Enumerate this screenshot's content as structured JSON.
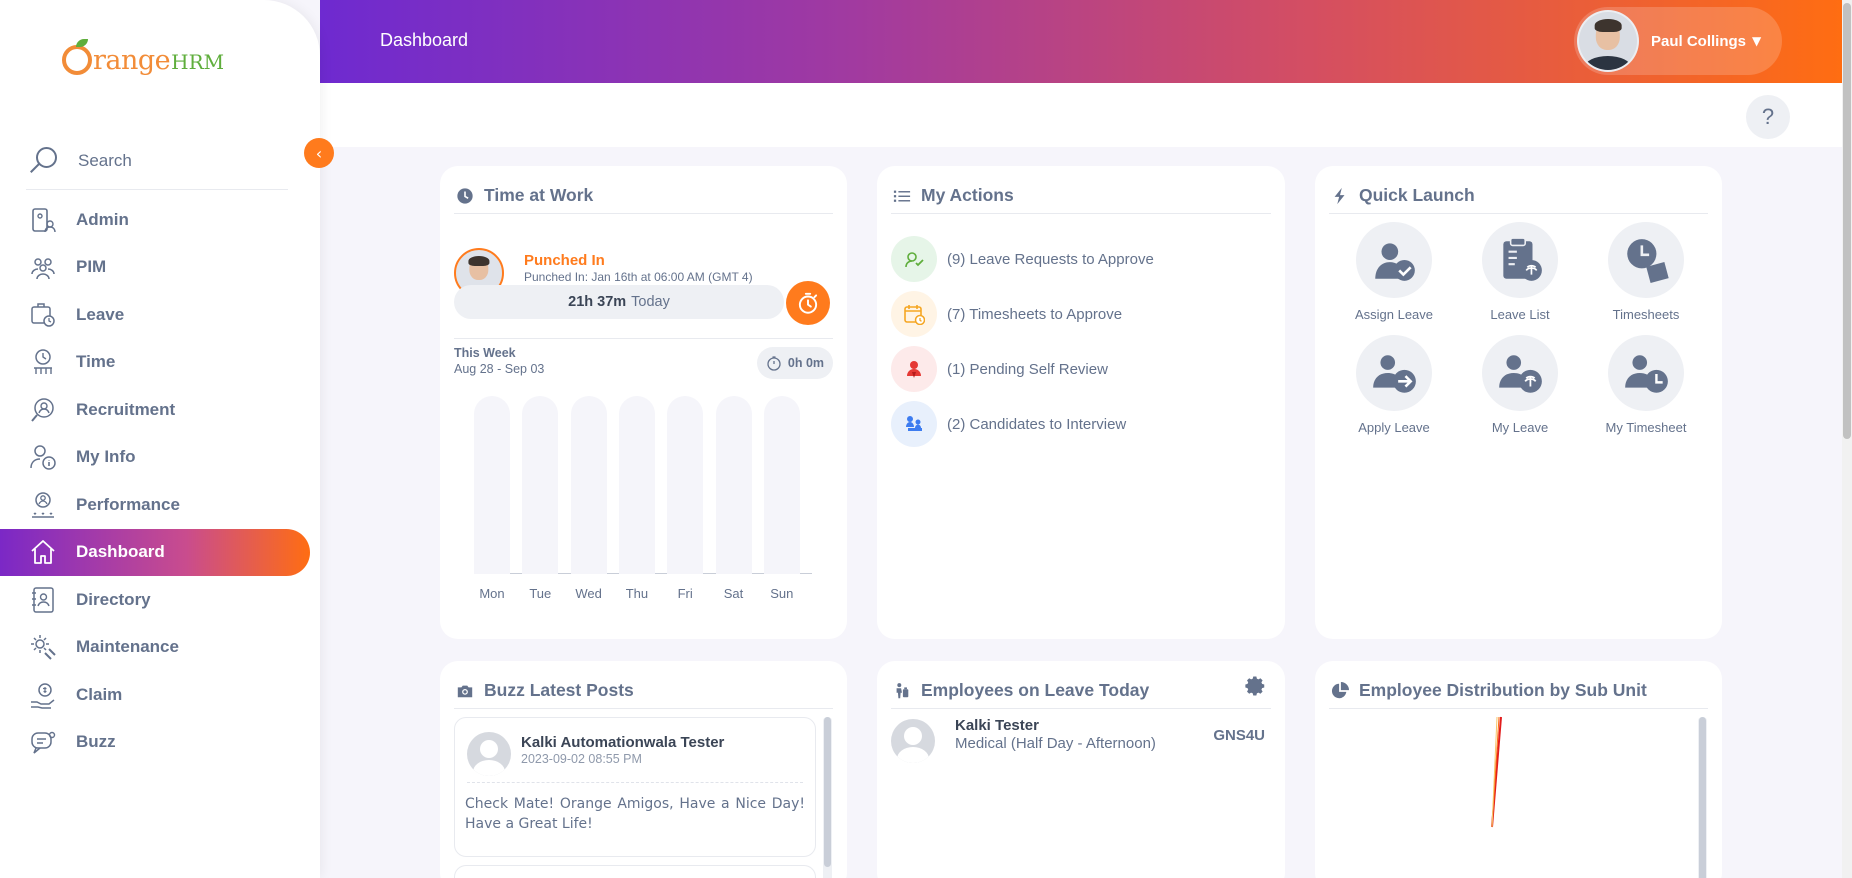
{
  "brand": {
    "logo_text": "range",
    "logo_suffix": "HRM"
  },
  "header": {
    "breadcrumb": "Dashboard",
    "user_name": "Paul Collings",
    "help_label": "?"
  },
  "sidebar": {
    "search_placeholder": "Search",
    "collapse_glyph": "‹",
    "items": [
      {
        "label": "Admin",
        "icon": "admin-icon"
      },
      {
        "label": "PIM",
        "icon": "pim-icon"
      },
      {
        "label": "Leave",
        "icon": "leave-icon"
      },
      {
        "label": "Time",
        "icon": "time-icon"
      },
      {
        "label": "Recruitment",
        "icon": "recruitment-icon"
      },
      {
        "label": "My Info",
        "icon": "my-info-icon"
      },
      {
        "label": "Performance",
        "icon": "performance-icon"
      },
      {
        "label": "Dashboard",
        "icon": "home-icon",
        "active": true
      },
      {
        "label": "Directory",
        "icon": "directory-icon"
      },
      {
        "label": "Maintenance",
        "icon": "maintenance-icon"
      },
      {
        "label": "Claim",
        "icon": "claim-icon"
      },
      {
        "label": "Buzz",
        "icon": "buzz-icon"
      }
    ]
  },
  "time_at_work": {
    "title": "Time at Work",
    "status": "Punched In",
    "punched_detail": "Punched In: Jan 16th at 06:00 AM (GMT 4)",
    "today_hours": "21h 37m",
    "today_label": "Today",
    "week_label": "This Week",
    "week_range": "Aug 28 - Sep 03",
    "week_total": "0h 0m",
    "days": [
      "Mon",
      "Tue",
      "Wed",
      "Thu",
      "Fri",
      "Sat",
      "Sun"
    ]
  },
  "my_actions": {
    "title": "My Actions",
    "items": [
      {
        "label": "(9) Leave Requests to Approve",
        "color": "#e6f5e8",
        "icon": "leave-request-icon"
      },
      {
        "label": "(7) Timesheets to Approve",
        "color": "#fff4e5",
        "icon": "timesheet-calendar-icon"
      },
      {
        "label": "(1) Pending Self Review",
        "color": "#fdeaea",
        "icon": "self-review-icon"
      },
      {
        "label": "(2) Candidates to Interview",
        "color": "#e8f0fc",
        "icon": "interview-icon"
      }
    ]
  },
  "quick_launch": {
    "title": "Quick Launch",
    "items": [
      {
        "label": "Assign Leave",
        "icon": "assign-leave-icon"
      },
      {
        "label": "Leave List",
        "icon": "leave-list-icon"
      },
      {
        "label": "Timesheets",
        "icon": "timesheets-icon"
      },
      {
        "label": "Apply Leave",
        "icon": "apply-leave-icon"
      },
      {
        "label": "My Leave",
        "icon": "my-leave-icon"
      },
      {
        "label": "My Timesheet",
        "icon": "my-timesheet-icon"
      }
    ]
  },
  "buzz": {
    "title": "Buzz Latest Posts",
    "posts": [
      {
        "author": "Kalki Automationwala Tester",
        "date": "2023-09-02 08:55 PM",
        "body": "Check Mate! Orange Amigos, Have a Nice Day! Have a Great Life!"
      }
    ]
  },
  "leave_today": {
    "title": "Employees on Leave Today",
    "rows": [
      {
        "name": "Kalki Tester",
        "type": "Medical (Half Day - Afternoon)",
        "code": "GNS4U"
      }
    ]
  },
  "distribution": {
    "title": "Employee Distribution by Sub Unit"
  },
  "colors": {
    "accent": "#ff7b1d",
    "text": "#64728c",
    "gradient_start": "#6e2ad0",
    "gradient_end": "#ff6d12"
  }
}
